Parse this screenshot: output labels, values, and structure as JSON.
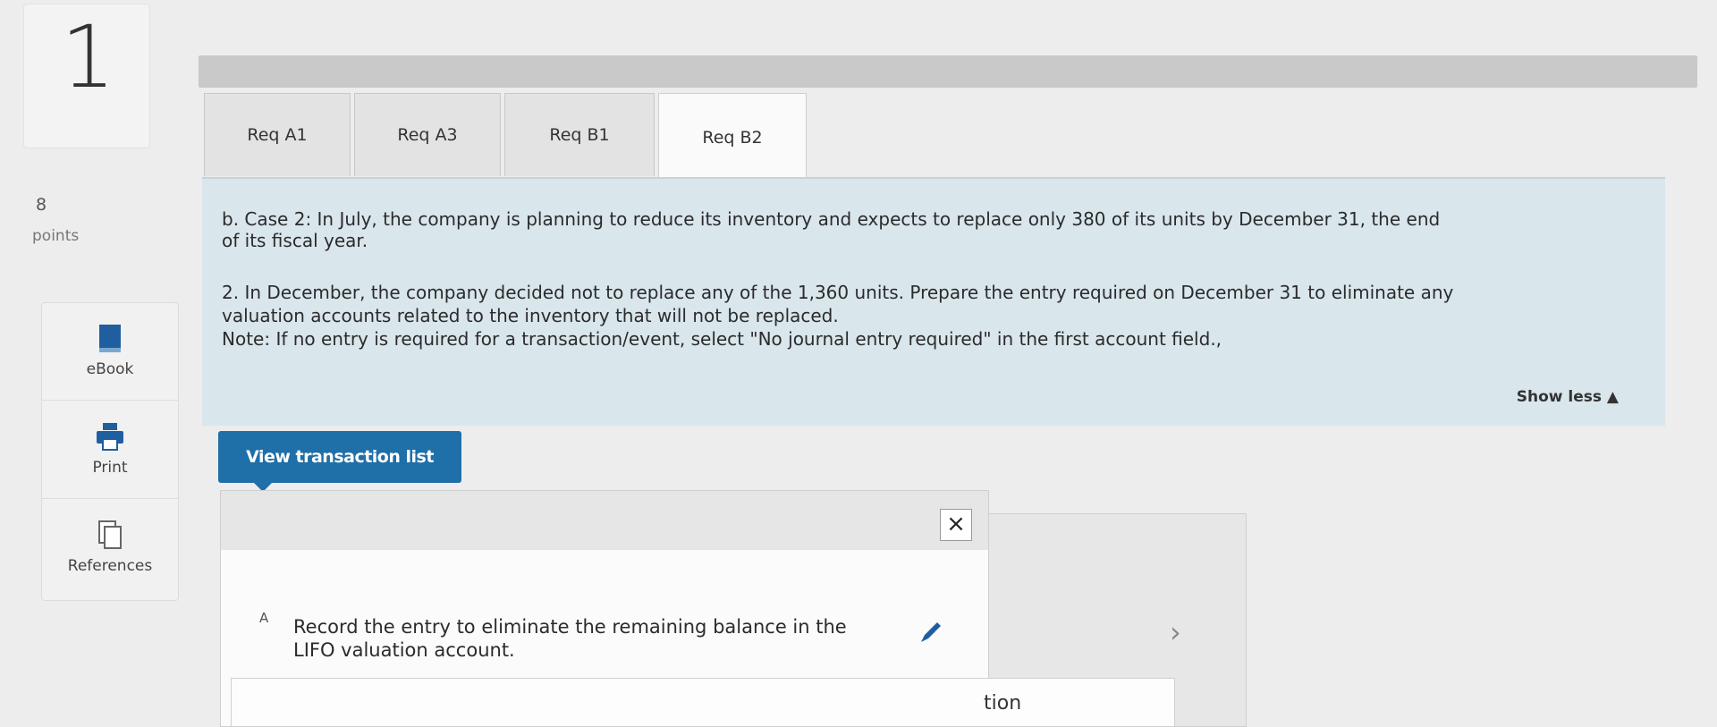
{
  "question": {
    "number": "1",
    "points_value": "8",
    "points_label": "points"
  },
  "tools": [
    {
      "label": "eBook",
      "icon": "book-icon"
    },
    {
      "label": "Print",
      "icon": "printer-icon"
    },
    {
      "label": "References",
      "icon": "references-icon"
    }
  ],
  "tabs": [
    {
      "label": "Req A1",
      "active": false
    },
    {
      "label": "Req A3",
      "active": false
    },
    {
      "label": "Req B1",
      "active": false
    },
    {
      "label": "Req B2",
      "active": true
    }
  ],
  "instructions": {
    "case_line1": "b. Case 2: In July, the company is planning to reduce its inventory and expects to replace only 380 of its units by December 31, the end",
    "case_line2": "of its fiscal year.",
    "req_line1": "2. In December, the company decided not to replace any of the 1,360 units. Prepare the entry required on December 31 to eliminate any",
    "req_line2": "valuation accounts related to the inventory that will not be replaced.",
    "note": "Note: If no entry is required for a transaction/event, select \"No journal entry required\" in the first account field.,",
    "show_less": "Show less ▲"
  },
  "view_transaction_list": "View transaction list",
  "transaction_panel": {
    "close_glyph": "×",
    "rows": [
      {
        "letter": "A",
        "text": "Record the entry to eliminate the remaining balance in the LIFO valuation account."
      }
    ],
    "partial_text": "tion"
  },
  "colors": {
    "accent": "#1f6fa8",
    "instructions_bg": "#d9e6ec",
    "tab_bg": "#e3e3e3"
  }
}
